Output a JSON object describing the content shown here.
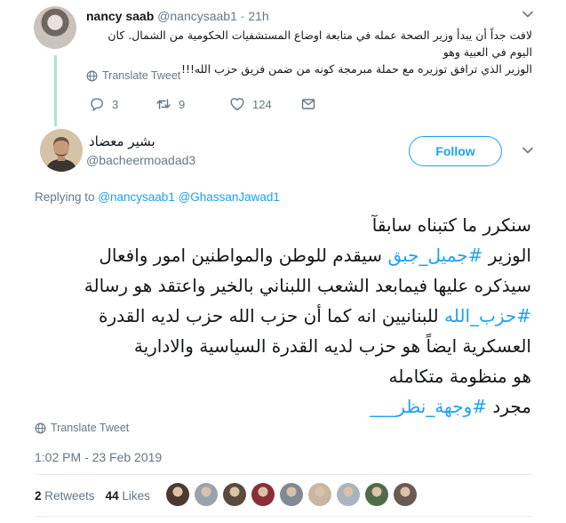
{
  "parent_tweet": {
    "author_name": "nancy saab",
    "author_handle": "@nancysaab1",
    "separator": "·",
    "time": "21h",
    "text_line1": "لافت جداً أن يبدأ وزير الصحة عمله في متابعة اوضاع المستشفيات الحكومية من الشمال. كان اليوم في العبية وهو",
    "text_line2": "الوزير الذي ترافق توزيره مع حملة مبرمجة كونه من ضمن فريق حزب الله!!!",
    "translate_label": "Translate Tweet",
    "replies": "3",
    "retweets": "9",
    "likes": "124"
  },
  "main_tweet": {
    "author_name": "بشير معضاد",
    "author_handle": "@bacheermoadad3",
    "follow_label": "Follow",
    "replying_prefix": "Replying to",
    "replying_to_1": "@nancysaab1",
    "replying_to_2": "@GhassanJawad1",
    "line1": "سنكرر ما كتبناه سابقآ",
    "line2_pre": "الوزير",
    "hashtag_1": "#جميل_جبق",
    "line2_post": "سيقدم للوطن والمواطنين امور وافعال",
    "line3": "سيذكره عليها فيمابعد الشعب اللبناني بالخير واعتقد هو رسالة",
    "hashtag_2": "#حزب_الله",
    "line4_post": "للبنانيين انه كما أن حزب الله حزب لديه القدرة",
    "line5": "العسكرية ايضاً هو حزب لديه القدرة السياسية والادارية",
    "line6": "هو منظومة متكامله",
    "line7_pre": "مجرد",
    "hashtag_3": "#وجهة_نظر___",
    "translate_label": "Translate Tweet",
    "timestamp": "1:02 PM - 23 Feb 2019",
    "retweet_count": "2",
    "retweet_label": "Retweets",
    "like_count": "44",
    "like_label": "Likes"
  },
  "liker_colors": [
    "#4a3a30",
    "#9aa3ad",
    "#5a4b3f",
    "#8a2f3a",
    "#7f8a95",
    "#c8b6a0",
    "#aab4bf",
    "#4f6b4a",
    "#6b5a52"
  ],
  "colors": {
    "accent": "#1da1f2",
    "muted": "#657786",
    "thread_line": "#a8e6cf"
  },
  "icons": [
    "chevron-down-icon",
    "globe-icon",
    "reply-icon",
    "retweet-icon",
    "heart-icon",
    "message-icon"
  ]
}
